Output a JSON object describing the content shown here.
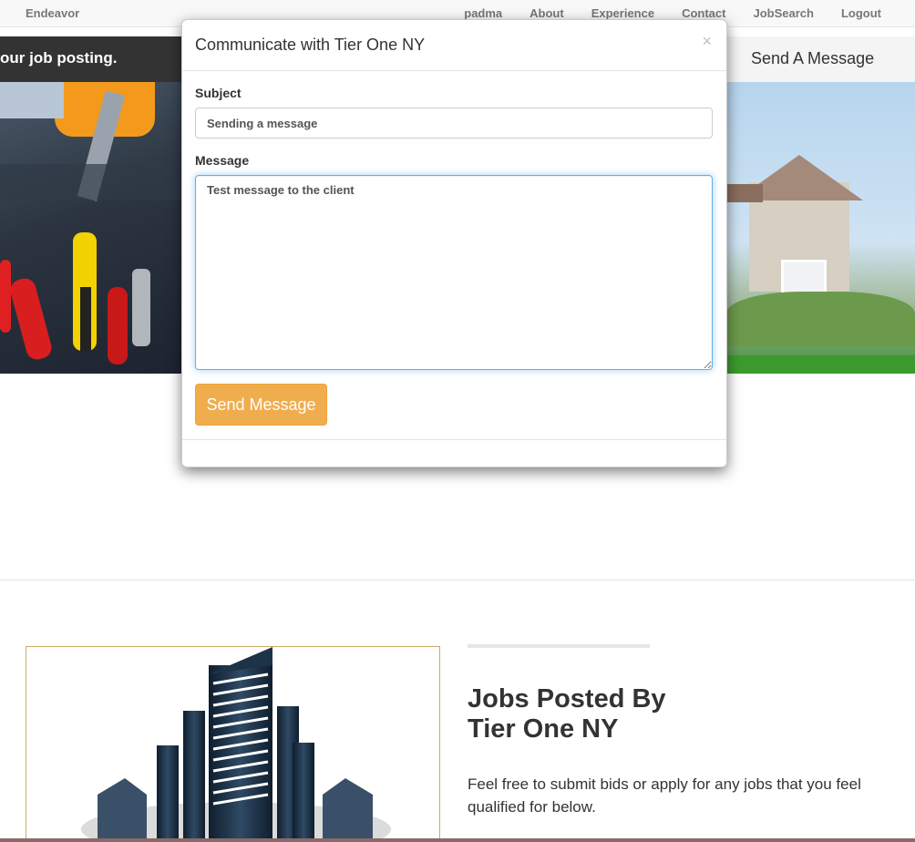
{
  "nav": {
    "brand": "Endeavor",
    "links": [
      "padma",
      "About",
      "Experience",
      "Contact",
      "JobSearch",
      "Logout"
    ]
  },
  "banner": {
    "left_text": "our job posting.",
    "right_text": "Send A Message"
  },
  "modal": {
    "title": "Communicate with Tier One NY",
    "close_glyph": "×",
    "subject_label": "Subject",
    "subject_value": "Sending a message",
    "message_label": "Message",
    "message_value": "Test message to the client",
    "send_label": "Send Message"
  },
  "section": {
    "title_line1": "Jobs Posted By",
    "title_line2": "Tier One NY",
    "description": "Feel free to submit bids or apply for any jobs that you feel qualified for below."
  },
  "colors": {
    "accent": "#f0ad4e",
    "banner_bg": "#333333",
    "focus_border": "#66afe9"
  }
}
